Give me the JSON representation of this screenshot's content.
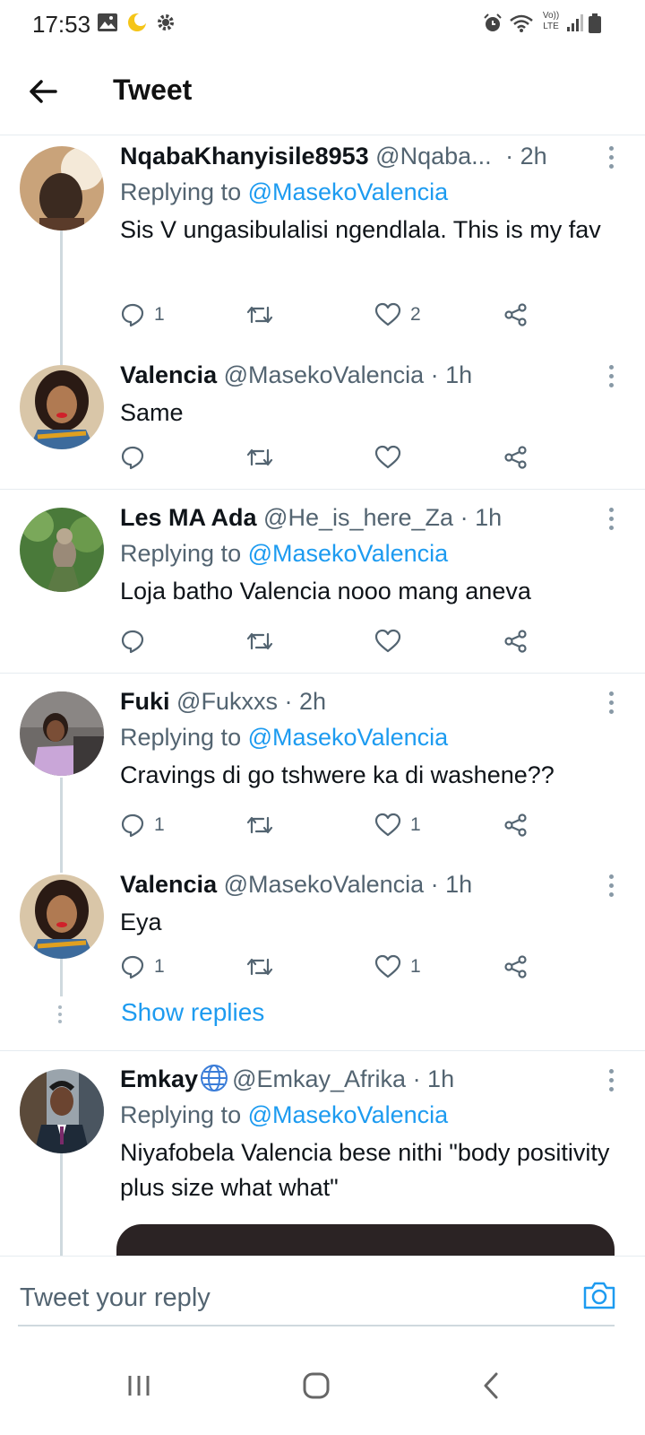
{
  "status_bar": {
    "time": "17:53",
    "network_label": "Vo)) LTE"
  },
  "header": {
    "title": "Tweet"
  },
  "tweets": [
    {
      "name": "NqabaKhanyisile8953",
      "handle": "@Nqaba...",
      "time": "· 2h",
      "replying_label": "Replying to",
      "replying_to": "@MasekoValencia",
      "text": "Sis V ungasibulalisi ngendlala. This is my fav",
      "reply_count": "1",
      "like_count": "2",
      "retweet_count": ""
    },
    {
      "name": "Valencia",
      "handle": "@MasekoValencia",
      "time": "· 1h",
      "text": "Same",
      "reply_count": "",
      "like_count": "",
      "retweet_count": ""
    },
    {
      "name": "Les MA Ada",
      "handle": "@He_is_here_Za",
      "time": "· 1h",
      "replying_label": "Replying to",
      "replying_to": "@MasekoValencia",
      "text": "Loja batho Valencia nooo mang aneva",
      "reply_count": "",
      "like_count": "",
      "retweet_count": ""
    },
    {
      "name": "Fuki",
      "handle": "@Fukxxs",
      "time": "· 2h",
      "replying_label": "Replying to",
      "replying_to": "@MasekoValencia",
      "text": "Cravings di go tshwere ka di washene??",
      "reply_count": "1",
      "like_count": "1",
      "retweet_count": ""
    },
    {
      "name": "Valencia",
      "handle": "@MasekoValencia",
      "time": "· 1h",
      "text": "Eya",
      "reply_count": "1",
      "like_count": "1",
      "retweet_count": ""
    },
    {
      "name": "Emkay",
      "handle": "@Emkay_Afrika",
      "time": "· 1h",
      "replying_label": "Replying to",
      "replying_to": "@MasekoValencia",
      "text": "Niyafobela Valencia bese nithi \"body positivity plus size what what\"",
      "reply_count": "",
      "like_count": "",
      "retweet_count": ""
    }
  ],
  "show_replies": "Show replies",
  "reply_bar": {
    "placeholder": "Tweet your reply"
  },
  "colors": {
    "accent": "#1d9bf0",
    "muted": "#536471",
    "text": "#0f1419",
    "divider": "#e6ecf0"
  }
}
